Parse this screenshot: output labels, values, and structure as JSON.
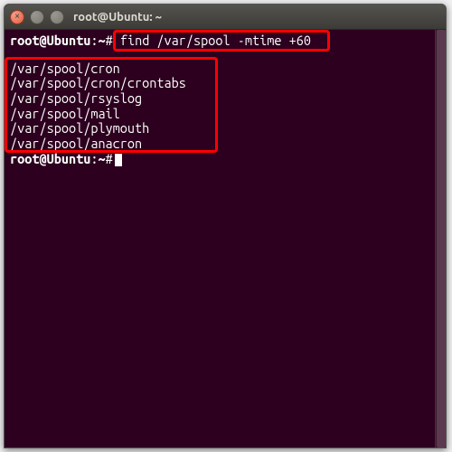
{
  "window": {
    "title": "root@Ubuntu: ~"
  },
  "prompt": {
    "user_host": "root@Ubuntu",
    "path_sep": ":",
    "path": "~",
    "symbol": "#"
  },
  "command": "find /var/spool -mtime +60",
  "output": [
    "/var/spool/cron",
    "/var/spool/cron/crontabs",
    "/var/spool/rsyslog",
    "/var/spool/mail",
    "/var/spool/plymouth",
    "/var/spool/anacron"
  ],
  "annotations": {
    "command_highlight": true,
    "output_highlight": true
  }
}
